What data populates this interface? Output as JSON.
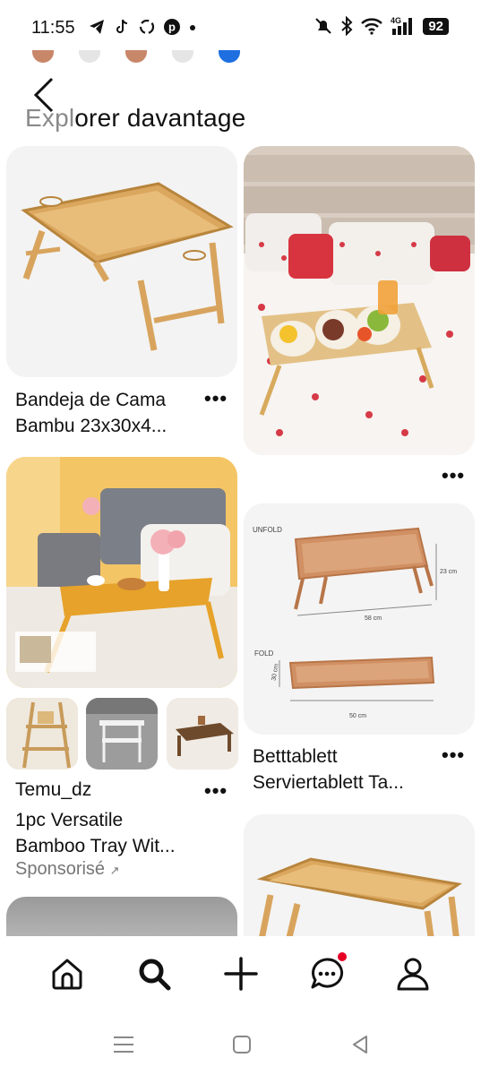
{
  "status_bar": {
    "time": "11:55",
    "battery": "92",
    "network": "4G"
  },
  "header": {
    "title_faded": "Expl",
    "title_rest": "orer davantage"
  },
  "swatches": [
    "#c9876a",
    "#e5e5e5",
    "#c9876a",
    "#e5e5e5",
    "#1f6fe0"
  ],
  "feed": {
    "pin1": {
      "title_line1": "Bandeja de Cama",
      "title_line2": "Bambu 23x30x4...",
      "more": "•••"
    },
    "pin2": {
      "more": "•••"
    },
    "pin3": {
      "advertiser": "Temu_dz",
      "title_line1": "1pc Versatile",
      "title_line2": "Bamboo Tray Wit...",
      "sponsored": "Sponsorisé",
      "sponsored_arrow": "↗",
      "more": "•••"
    },
    "pin4": {
      "unfold_label": "UNFOLD",
      "fold_label": "FOLD",
      "dim_height": "23 cm",
      "dim_width": "58 cm",
      "dim_fold_height": "30 cm",
      "dim_fold_width": "50 cm",
      "title_line1": "Betttablett",
      "title_line2": "Serviertablett Ta...",
      "more": "•••"
    }
  },
  "bottom_nav": {
    "items": [
      "home-icon",
      "search-icon",
      "create-icon",
      "messages-icon",
      "profile-icon"
    ]
  },
  "system_nav": {
    "items": [
      "recents-icon",
      "home-square-icon",
      "back-triangle-icon"
    ]
  }
}
